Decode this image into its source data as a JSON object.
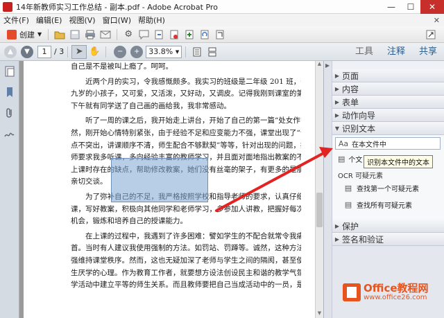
{
  "window": {
    "title": "14年新教师实习工作总结 - 副本.pdf - Adobe Acrobat Pro",
    "min": "—",
    "max": "☐",
    "close": "✕"
  },
  "menu": [
    "文件(F)",
    "编辑(E)",
    "视图(V)",
    "窗口(W)",
    "帮助(H)"
  ],
  "menu_close": "✕",
  "toolbar": {
    "create_label": "创建"
  },
  "nav": {
    "page_current": "1",
    "page_total": "/ 3",
    "zoom": "33.8%"
  },
  "panel_tabs": [
    {
      "label": "工具",
      "active": false
    },
    {
      "label": "注释",
      "active": true
    },
    {
      "label": "共享",
      "active": true
    }
  ],
  "document": {
    "lines": [
      "自己是不是被叫上瘾了。呵呵。",
      "　　近两个月的实习，令我感慨颇多。我实习的班级是二年级 201 班，一大群八",
      "九岁的小孩子，又可爱，又活泼，又好动，又调皮。记得我刚到课室的第一天，",
      "下午就有同学送了自己画的画给我，我非常感动。",
      "　　听了一周的课之后，我开始走上讲台，开始了自己的第一篇“处女作”。当",
      "然，刚开始心情特别紧张，由于经验不足和应变能力不强，课堂出现了“讲课重",
      "点不突出，讲课顺序不清，师生配合不够默契”等等，针对出现的问题，指导老",
      "师要求我多听课，多向经验丰富的教师学习，并且面对面地指出教案的不足以及",
      "上课时存在的缺点，帮助修改教案，她们没有丝毫的架子，有更多的是朋友般的",
      "亲切交谈。",
      "　　为了弥补自己的不足，我严格按照学校和指导老师的要求，认真仔细地备好",
      "课，写好教案，积极向其他同学和老师学习，多参加人讲教，把握好每次上台的",
      "机会，锻炼和培养自己的授课能力。",
      "　　在上课的过程中，我遇到了许多困难：譬如学生的不配合就常令我痛心疾",
      "首。当时有人建议我使用强制的方法。如罚站、罚蹲等。诚然，这种方法可以勉",
      "强维持课堂秩序。然而，这也无疑加深了老师与学生之间的隔阂，甚至使学生产",
      "生厌学的心理。作为教育工作者，就要想方设法创设民主和谐的教学气氛，在教",
      "学活动中建立平等的师生关系。而且教师要把自己当成活动中的一员，是学生们"
    ]
  },
  "right_panel": {
    "sections_top": [
      "页面",
      "内容",
      "表单",
      "动作向导"
    ],
    "recognize": {
      "title": "识别文本",
      "btn_in_file": "在本文件中",
      "btn_multi": "在多个文件中",
      "tooltip": "识别本文件中的文本",
      "ocr_head": "OCR 可疑元素",
      "find_first": "查找第一个可疑元素",
      "find_all": "查找所有可疑元素"
    },
    "sections_bottom": [
      "保护",
      "签名和验证"
    ]
  },
  "watermark": {
    "brand": "Office教程网",
    "url": "www.office26.com"
  },
  "colors": {
    "accent_tab": "#2b5d8c",
    "selection": "#7da6d2",
    "arrow": "#e32222",
    "watermark": "#e8541e"
  }
}
